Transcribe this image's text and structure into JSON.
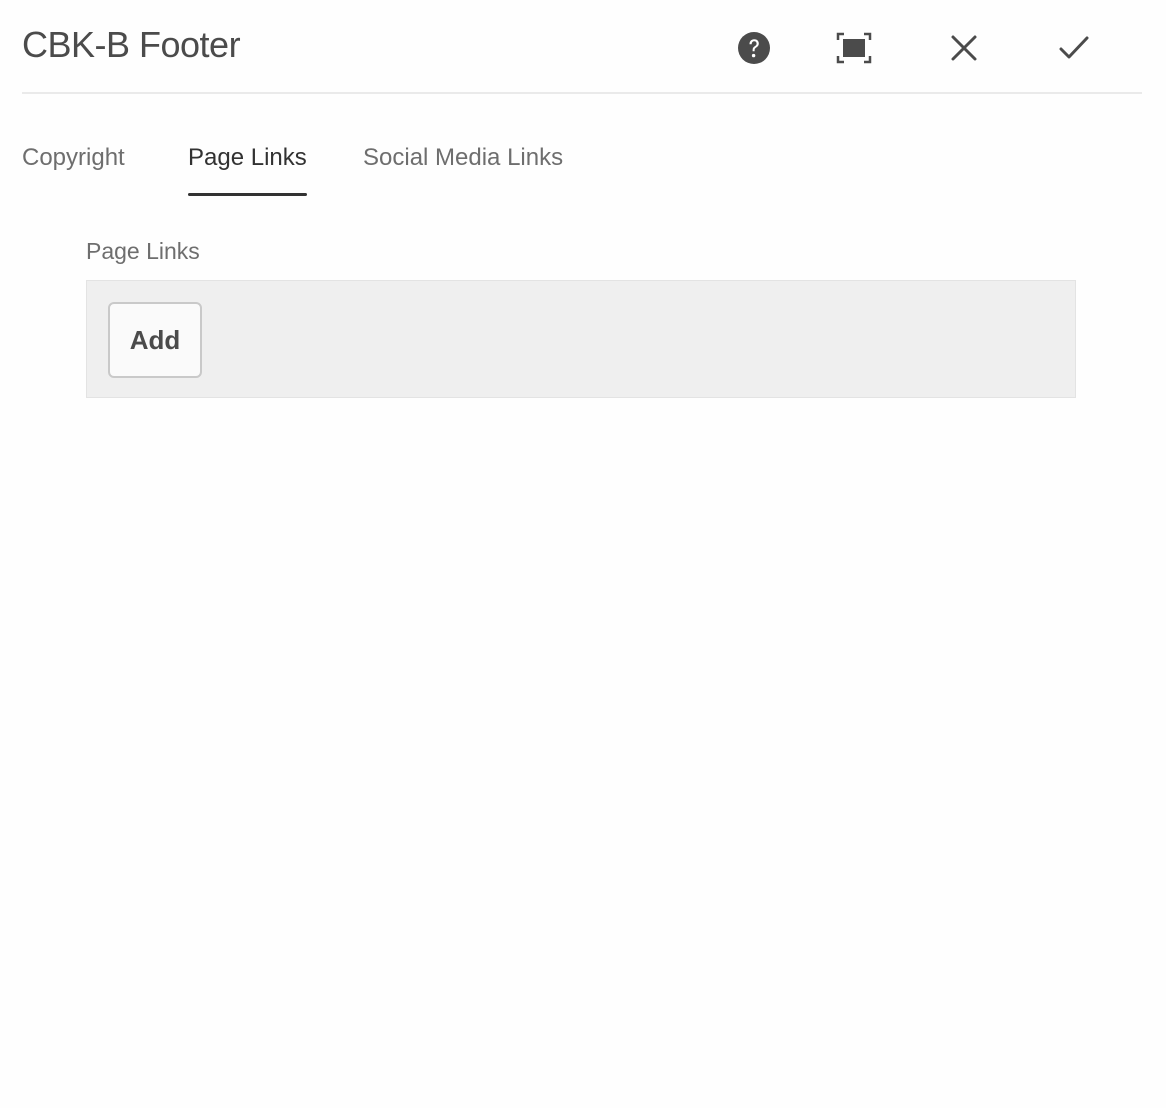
{
  "dialog": {
    "title": "CBK-B Footer",
    "actions": {
      "help_icon": "help-circle-icon",
      "fullscreen_icon": "fullscreen-icon",
      "close_icon": "close-icon",
      "done_icon": "checkmark-icon"
    }
  },
  "tabs": [
    {
      "label": "Copyright",
      "active": false
    },
    {
      "label": "Page Links",
      "active": true
    },
    {
      "label": "Social Media Links",
      "active": false
    }
  ],
  "page_links": {
    "label": "Page Links",
    "add_label": "Add"
  },
  "colors": {
    "text": "#4b4b4b",
    "tab_inactive": "#6e6e6e",
    "tab_active": "#323232",
    "multifield_bg": "#efefef"
  }
}
